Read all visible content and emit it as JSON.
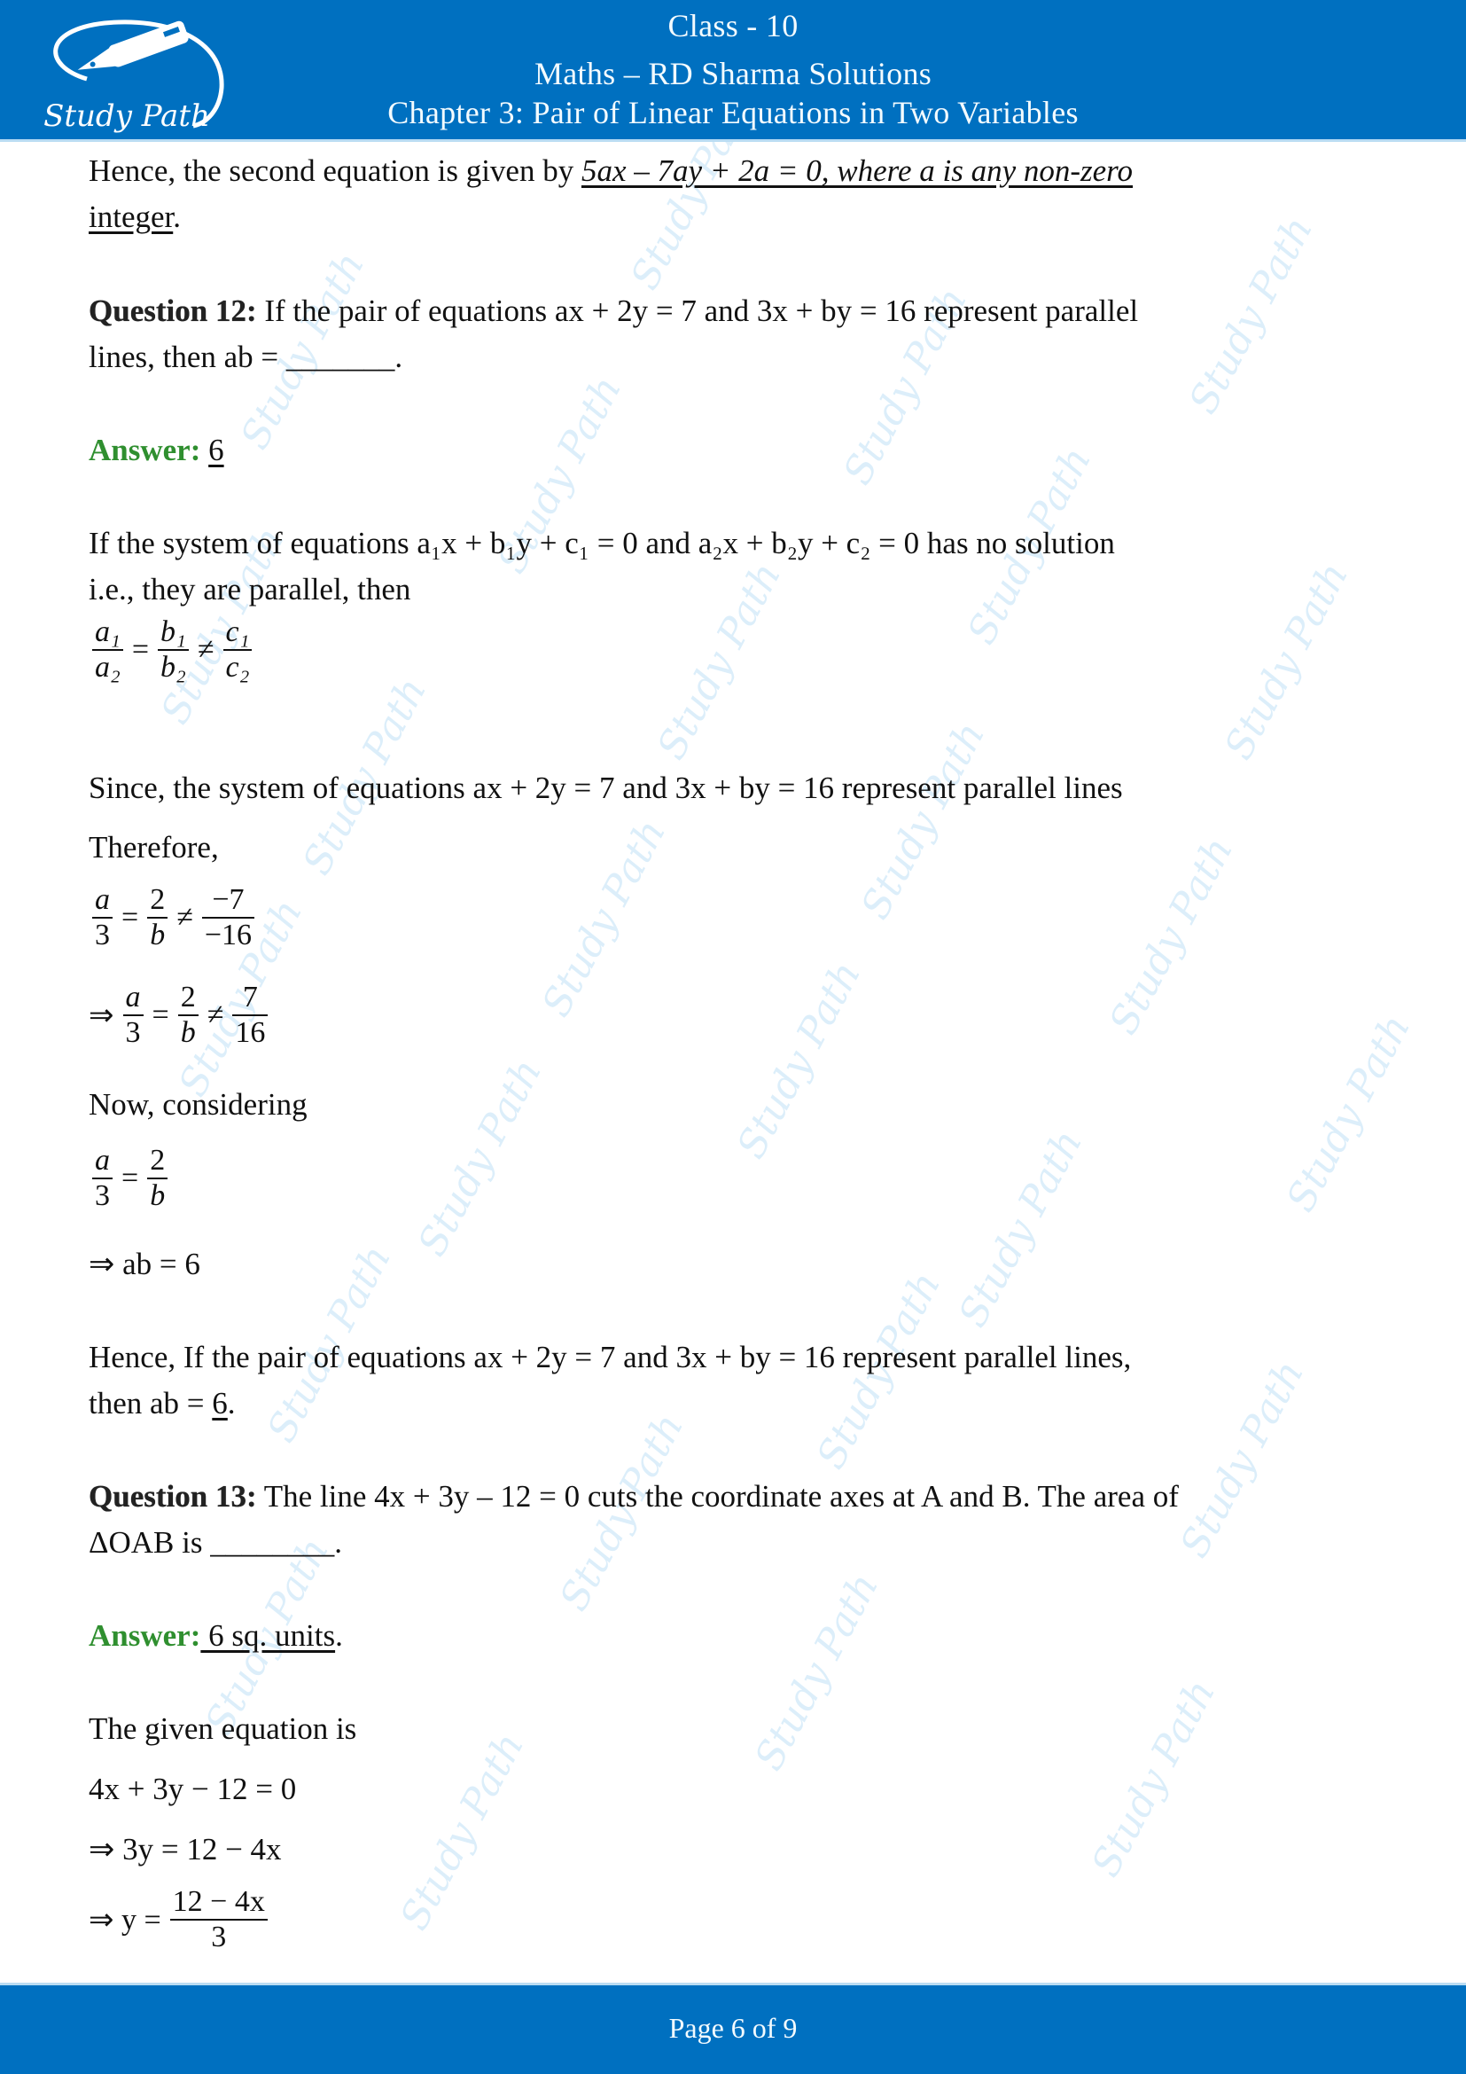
{
  "header": {
    "logo_text": "Study Path",
    "class_line": "Class - 10",
    "subject_line": "Maths – RD Sharma Solutions",
    "chapter_line": "Chapter 3: Pair of Linear Equations in Two Variables"
  },
  "colors": {
    "brand_blue": "#0070c0",
    "answer_green": "#2f8f2f",
    "watermark": "#d6ecfa"
  },
  "watermark_text": "Study Path",
  "body": {
    "intro_prefix": "Hence, the second equation is given by ",
    "intro_equation": "5ax – 7ay + 2a = 0, where a is any non-zero",
    "intro_end": "integer",
    "intro_period": ".",
    "q12": {
      "label": "Question 12:",
      "text_1": " If the pair of equations ax + 2y = 7 and 3x + by = 16 represent parallel",
      "text_2": "lines, then ab = _______.",
      "answer_label": "Answer:",
      "answer_value": "6",
      "cond_text_1": "If the system of equations a₁x + b₁y + c₁ = 0 and a₂x + b₂y + c₂ = 0 has no solution",
      "cond_text_2": "i.e., they are parallel, then",
      "ratio": {
        "n1": "a₁",
        "d1": "a₂",
        "op1": "=",
        "n2": "b₁",
        "d2": "b₂",
        "op2": "≠",
        "n3": "c₁",
        "d3": "c₂"
      },
      "since_text": "Since, the system of equations ax + 2y = 7 and 3x + by = 16 represent parallel lines",
      "therefore": "Therefore,",
      "step1": {
        "n1": "a",
        "d1": "3",
        "op1": "=",
        "n2": "2",
        "d2": "b",
        "op2": "≠",
        "n3": "−7",
        "d3": "−16"
      },
      "step2": {
        "prefix": "⇒",
        "n1": "a",
        "d1": "3",
        "op1": "=",
        "n2": "2",
        "d2": "b",
        "op2": "≠",
        "n3": "7",
        "d3": "16"
      },
      "now_considering": "Now, considering",
      "step3": {
        "n1": "a",
        "d1": "3",
        "op1": "=",
        "n2": "2",
        "d2": "b"
      },
      "result": "⇒ ab = 6",
      "conclusion_1": "Hence, If the pair of equations ax + 2y = 7 and 3x + by = 16 represent parallel lines,",
      "conclusion_2_prefix": "then ab = ",
      "conclusion_2_value": "6",
      "conclusion_2_end": "."
    },
    "q13": {
      "label": "Question 13:",
      "text_1": " The line 4x + 3y – 12 = 0 cuts the coordinate axes at A and B. The area of",
      "text_2": "ΔOAB is ________.",
      "answer_label": "Answer:",
      "answer_value": " 6 sq. units",
      "answer_end": ".",
      "given": "The given equation is",
      "eq1": "4x + 3y − 12 = 0",
      "eq2": "⇒ 3y = 12 − 4x",
      "eq3": {
        "prefix": "⇒ y =",
        "num": "12 − 4x",
        "den": "3"
      }
    }
  },
  "footer": {
    "page_label": "Page 6 of 9"
  }
}
